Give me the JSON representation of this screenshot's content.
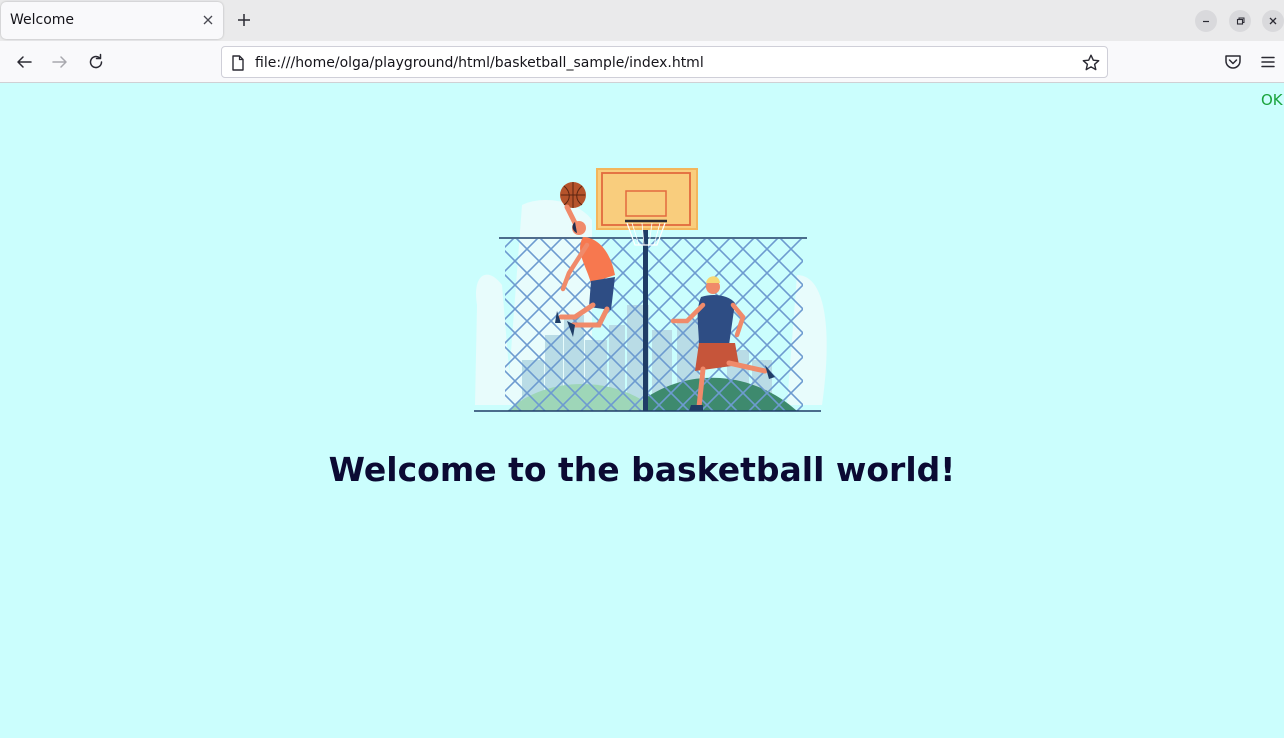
{
  "browser": {
    "tab": {
      "title": "Welcome"
    },
    "url": "file:///home/olga/playground/html/basketball_sample/index.html"
  },
  "page": {
    "status": "OK",
    "heading": "Welcome to the basketball world!"
  },
  "icons": [
    "close-icon",
    "plus-icon",
    "minimize-icon",
    "restore-icon",
    "back-arrow-icon",
    "forward-arrow-icon",
    "reload-icon",
    "page-icon",
    "star-icon",
    "pocket-icon",
    "hamburger-menu-icon"
  ],
  "colors": {
    "page_background": "#cbfefd",
    "heading": "#0b0a33",
    "status": "#1aa33c"
  }
}
